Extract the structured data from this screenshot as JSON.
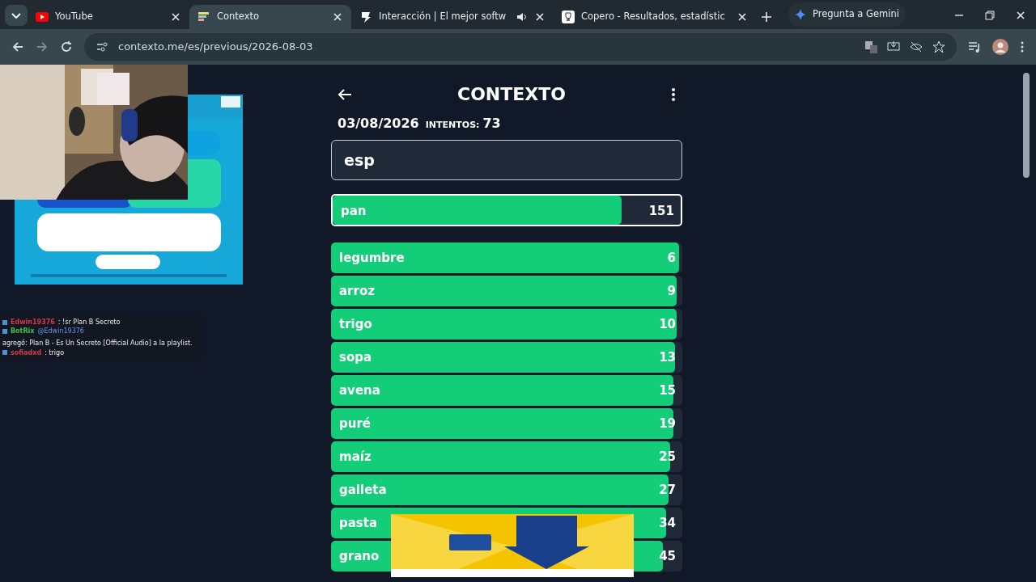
{
  "browser": {
    "tabs": [
      {
        "title": "YouTube",
        "kind": "youtube",
        "selected": false,
        "audio": false
      },
      {
        "title": "Contexto",
        "kind": "contexto",
        "selected": true,
        "audio": false
      },
      {
        "title": "Interacción | El mejor softw",
        "kind": "bolt",
        "selected": false,
        "audio": true
      },
      {
        "title": "Copero - Resultados, estadístic",
        "kind": "trophy",
        "selected": false,
        "audio": false
      }
    ],
    "gemini_button": "Pregunta a Gemini",
    "url": "contexto.me/es/previous/2026-08-03"
  },
  "chat": [
    {
      "user": "Edwin19376",
      "color": "#d23a4c",
      "message": ": !sr Plan B Secreto"
    },
    {
      "user": "BotRix",
      "color": "#3fbf4f",
      "mention": "@Edwin19376",
      "message": "agregó: Plan B - Es Un Secreto [Official Audio] a la playlist."
    },
    {
      "user": "sofiadxd",
      "color": "#d23a4c",
      "message": ": trigo"
    }
  ],
  "game": {
    "title": "CONTEXTO",
    "date": "03/08/2026",
    "attempts_label": "INTENTOS:",
    "attempts": "73",
    "input_value": "esp",
    "latest": {
      "word": "pan",
      "rank": "151",
      "level": 0.83
    },
    "guesses": [
      {
        "word": "legumbre",
        "rank": "6",
        "level": 0.99
      },
      {
        "word": "arroz",
        "rank": "9",
        "level": 0.985
      },
      {
        "word": "trigo",
        "rank": "10",
        "level": 0.985
      },
      {
        "word": "sopa",
        "rank": "13",
        "level": 0.98
      },
      {
        "word": "avena",
        "rank": "15",
        "level": 0.975
      },
      {
        "word": "puré",
        "rank": "19",
        "level": 0.975
      },
      {
        "word": "maíz",
        "rank": "25",
        "level": 0.965
      },
      {
        "word": "galleta",
        "rank": "27",
        "level": 0.96
      },
      {
        "word": "pasta",
        "rank": "34",
        "level": 0.955
      },
      {
        "word": "grano",
        "rank": "45",
        "level": 0.945
      }
    ]
  }
}
